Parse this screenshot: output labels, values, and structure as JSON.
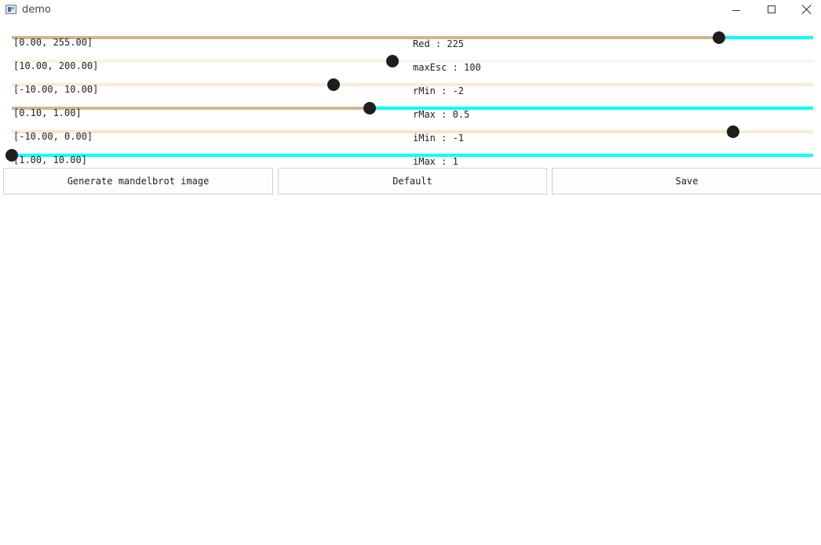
{
  "window": {
    "title": "demo"
  },
  "sliders": [
    {
      "range_label": "[0.00, 255.00]",
      "value_label": "Red : 225",
      "fraction": 0.882,
      "track_color": "#00ffff",
      "fill_color": "#d2b48c"
    },
    {
      "range_label": "[10.00, 200.00]",
      "value_label": "maxEsc : 100",
      "fraction": 0.475,
      "track_color": "#f0f8ff",
      "fill_color": "#f5f5dc"
    },
    {
      "range_label": "[-10.00, 10.00]",
      "value_label": "rMin : -2",
      "fraction": 0.402,
      "track_color": "#faebd7",
      "fill_color": "#faebd7"
    },
    {
      "range_label": "[0.10, 1.00]",
      "value_label": "rMax : 0.5",
      "fraction": 0.447,
      "track_color": "#00ffff",
      "fill_color": "#d2b48c"
    },
    {
      "range_label": "[-10.00, 0.00]",
      "value_label": "iMin : -1",
      "fraction": 0.9,
      "track_color": "#faebd7",
      "fill_color": "#ffe4c4"
    },
    {
      "range_label": "[1.00, 10.00]",
      "value_label": "iMax : 1",
      "fraction": 0.0,
      "track_color": "#00ffff",
      "fill_color": "#d2b48c"
    }
  ],
  "buttons": {
    "generate": "Generate mandelbrot image",
    "default": "Default",
    "save": "Save"
  }
}
